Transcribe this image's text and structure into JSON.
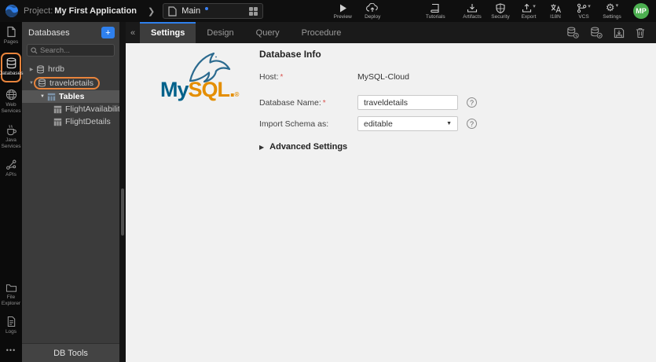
{
  "topbar": {
    "project_label": "Project:",
    "project_name": "My First Application",
    "page": "Main",
    "actions": {
      "preview": "Preview",
      "deploy": "Deploy",
      "tutorials": "Tutorials",
      "artifacts": "Artifacts",
      "security": "Security",
      "export": "Export",
      "i18n": "I18N",
      "vcs": "VCS",
      "settings": "Settings"
    },
    "avatar": "MP"
  },
  "sidebar": {
    "items": [
      {
        "label": "Pages"
      },
      {
        "label": "Databases",
        "active": true
      },
      {
        "label": "Web Services"
      },
      {
        "label": "Java Services"
      },
      {
        "label": "APIs"
      }
    ],
    "bottom": [
      {
        "label": "File Explorer"
      },
      {
        "label": "Logs"
      }
    ]
  },
  "panel": {
    "title": "Databases",
    "search_placeholder": "Search...",
    "tree": [
      {
        "label": "hrdb",
        "type": "database",
        "expanded": false
      },
      {
        "label": "traveldetails",
        "type": "database",
        "expanded": true,
        "highlighted": true
      },
      {
        "label": "Tables",
        "type": "table-folder",
        "expanded": true,
        "selected": true
      },
      {
        "label": "FlightAvailability",
        "type": "table"
      },
      {
        "label": "FlightDetails",
        "type": "table"
      }
    ],
    "footer": "DB Tools"
  },
  "main": {
    "tabs": [
      {
        "label": "Settings",
        "active": true
      },
      {
        "label": "Design"
      },
      {
        "label": "Query"
      },
      {
        "label": "Procedure"
      }
    ],
    "logo": {
      "my": "My",
      "sql": "SQL",
      "reg": "®"
    },
    "form": {
      "heading": "Database Info",
      "required_marker": "*",
      "host_label": "Host:",
      "host_value": "MySQL-Cloud",
      "dbname_label": "Database Name:",
      "dbname_value": "traveldetails",
      "schema_label": "Import Schema as:",
      "schema_value": "editable",
      "advanced_label": "Advanced Settings"
    }
  },
  "icons": {
    "collapse": "«",
    "caret_right": "▶",
    "caret_down": "▼",
    "dropdown_caret": "▾",
    "ellipsis": "•••",
    "help": "?",
    "gear": "⚙",
    "chevron_right": "❯"
  },
  "colors": {
    "accent_blue": "#2f80ed",
    "highlight_orange": "#e8843c",
    "mysql_blue": "#00618a",
    "mysql_orange": "#e48e00",
    "avatar_green": "#4caf50"
  }
}
